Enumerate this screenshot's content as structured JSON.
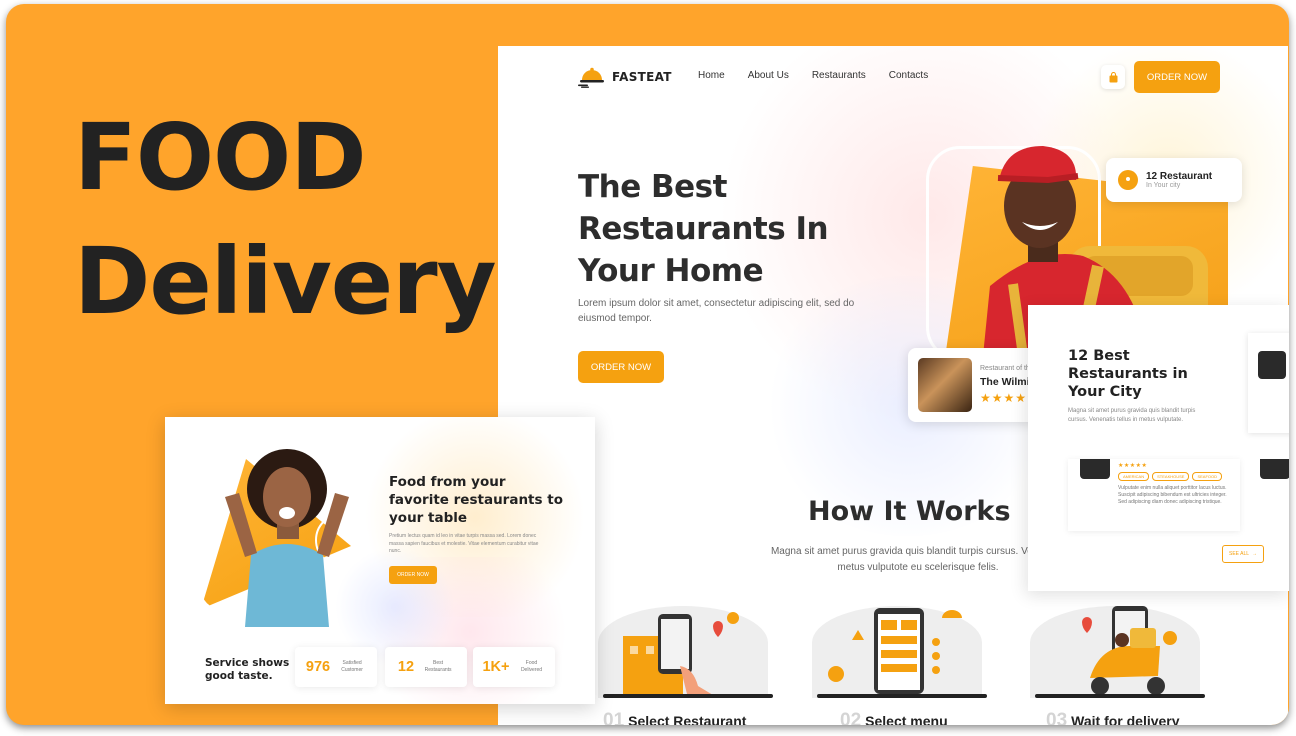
{
  "colors": {
    "background": "#FFA42B",
    "accent": "#F5A110",
    "text_dark": "#2D2D2D"
  },
  "hero": {
    "line1": "FOOD",
    "line2": "Delivery"
  },
  "main": {
    "brand": "FASTEAT",
    "nav": [
      "Home",
      "About Us",
      "Restaurants",
      "Contacts"
    ],
    "cart_icon": "shopping-bag-icon",
    "order_now": "ORDER NOW",
    "headline": [
      "The Best",
      "Restaurants In",
      "Your Home"
    ],
    "lead": "Lorem ipsum dolor sit amet, consectetur adipiscing elit, sed do eiusmod tempor.",
    "order_now_cta": "ORDER NOW",
    "badge": {
      "title": "12 Restaurant",
      "subtitle": "In Your city"
    },
    "card": {
      "subtitle": "Restaurant of th",
      "name": "The Wilmin",
      "stars": "★★★★★"
    },
    "how": {
      "title": "How It Works",
      "desc_line1": "Magna sit amet purus gravida quis blandit turpis cursus. Venenatis",
      "desc_line2": "metus vulputote eu scelerisque felis.",
      "steps": [
        {
          "num": "01",
          "label": "Select Restaurant"
        },
        {
          "num": "02",
          "label": "Select menu"
        },
        {
          "num": "03",
          "label": "Wait for delivery"
        }
      ]
    }
  },
  "side": {
    "title": "12 Best Restaurants in Your City",
    "text": "Magna sit amet purus gravida quis blandit turpis cursus. Venenatis tellus in metus vulputate.",
    "card_stars": "★★★★★",
    "tags": [
      "AMERICAN",
      "STEAKHOUSE",
      "SEAFOOD"
    ],
    "card_text": "Vulputate enim nulla aliquet porttitor lacus luctus. Suscipit adipiscing bibendum est ultricies integer. Sed adipiscing diam donec adipiscing tristique.",
    "see_all": "SEE ALL"
  },
  "second": {
    "title": "Food from your favorite restaurants to your table",
    "text": "Pretium lectus quam id leo in vitae turpis massa sed. Lorem donec massa sapien faucibus et molestie. Vitae elementum curabitur vitae nunc.",
    "order_now": "ORDER NOW",
    "taste": "Service shows good taste.",
    "stats": [
      {
        "value": "976",
        "label": "Satisfied Customer"
      },
      {
        "value": "12",
        "label": "Best Restaurants"
      },
      {
        "value": "1K+",
        "label": "Food Delivered"
      }
    ]
  }
}
